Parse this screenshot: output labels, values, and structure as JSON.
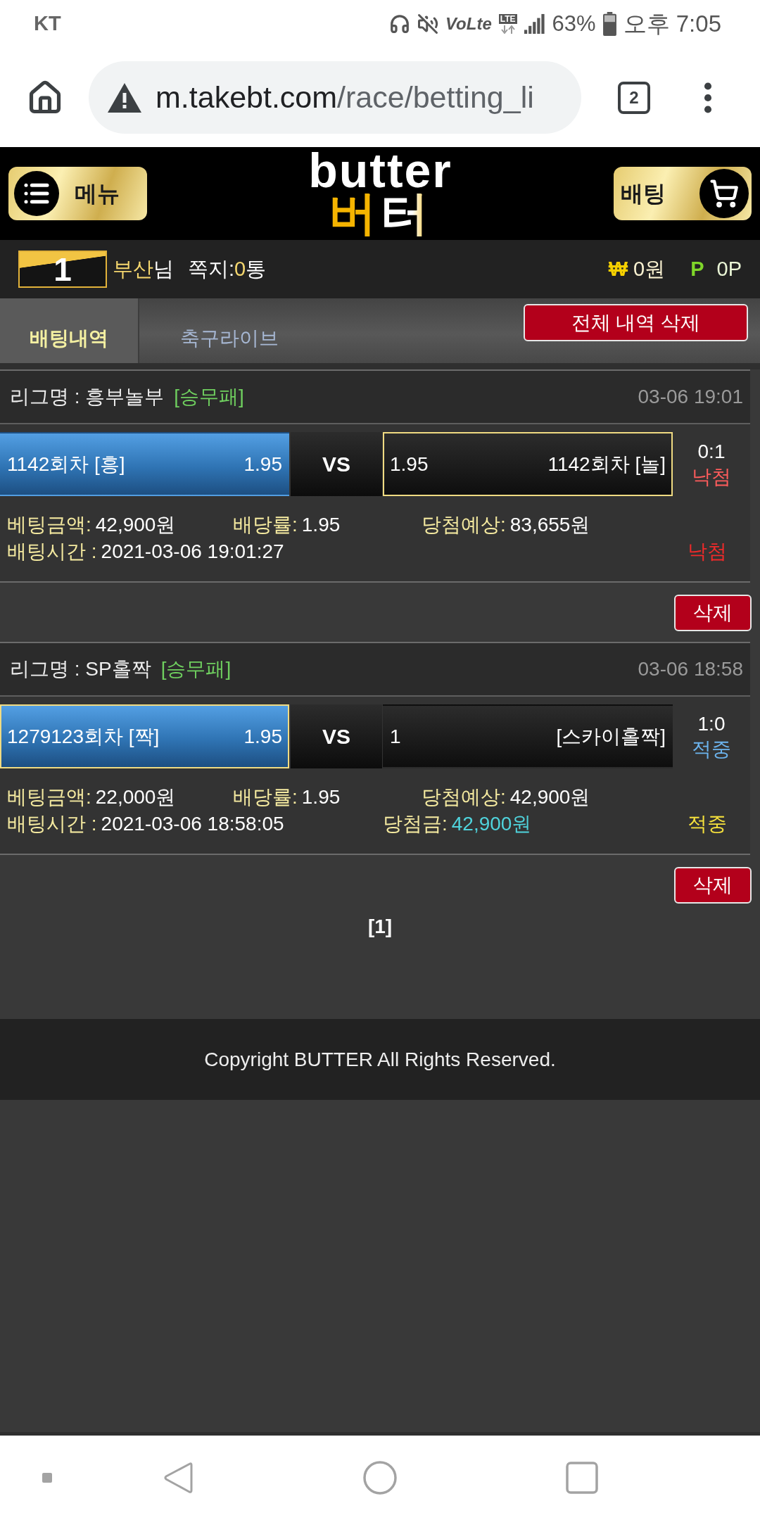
{
  "status_bar": {
    "carrier": "KT",
    "volte": "VoLte",
    "lte": "LTE",
    "battery": "63%",
    "time": "오후 7:05"
  },
  "browser": {
    "url_host": "m.takebt.com",
    "url_path": "/race/betting_li",
    "tab_count": "2"
  },
  "header": {
    "menu_label": "메뉴",
    "logo_top": "butter",
    "logo_bottom": "버터",
    "bet_label": "배팅"
  },
  "user": {
    "rank": "1",
    "name": "부산",
    "honorific": "님",
    "messages_label": "쪽지:",
    "messages_count": "0",
    "messages_unit": "통",
    "cash_symbol": "₩",
    "cash": "0원",
    "points_symbol": "P",
    "points": "0P"
  },
  "tabs": [
    {
      "label": "배팅내역",
      "selected": true
    },
    {
      "label": "축구라이브",
      "selected": false
    }
  ],
  "delete_all_button": "전체 내역 삭제",
  "bets": [
    {
      "league": "리그명 : 흥부놀부",
      "market": "[승무패]",
      "time": "03-06 19:01",
      "home": {
        "name": "1142회차 [흥]",
        "odds": "1.95",
        "picked": true,
        "winner": false
      },
      "vs": "VS",
      "away": {
        "odds": "1.95",
        "name": "1142회차 [놀]",
        "picked": false,
        "winner": true
      },
      "score": "0:1",
      "score_status": "낙첨",
      "won": false,
      "amount_label": "베팅금액:",
      "amount": "42,900원",
      "odds_label": "배당률:",
      "odds": "1.95",
      "expected_label": "당첨예상:",
      "expected": "83,655원",
      "time_label": "배팅시간 :",
      "bet_time": "2021-03-06 19:01:27",
      "status": "낙첨",
      "delete_button": "삭제"
    },
    {
      "league": "리그명 : SP홀짝",
      "market": "[승무패]",
      "time": "03-06 18:58",
      "home": {
        "name": "1279123회차 [짝]",
        "odds": "1.95",
        "picked": true,
        "winner": true
      },
      "vs": "VS",
      "away": {
        "odds": "1",
        "name": "[스카이홀짝]",
        "picked": false,
        "winner": false
      },
      "score": "1:0",
      "score_status": "적중",
      "won": true,
      "amount_label": "베팅금액:",
      "amount": "22,000원",
      "odds_label": "배당률:",
      "odds": "1.95",
      "expected_label": "당첨예상:",
      "expected": "42,900원",
      "time_label": "배팅시간 :",
      "bet_time": "2021-03-06 18:58:05",
      "payout_label": "당첨금:",
      "payout": "42,900원",
      "status": "적중",
      "delete_button": "삭제"
    }
  ],
  "pagination": "[1]",
  "footer": "Copyright BUTTER All Rights Reserved."
}
